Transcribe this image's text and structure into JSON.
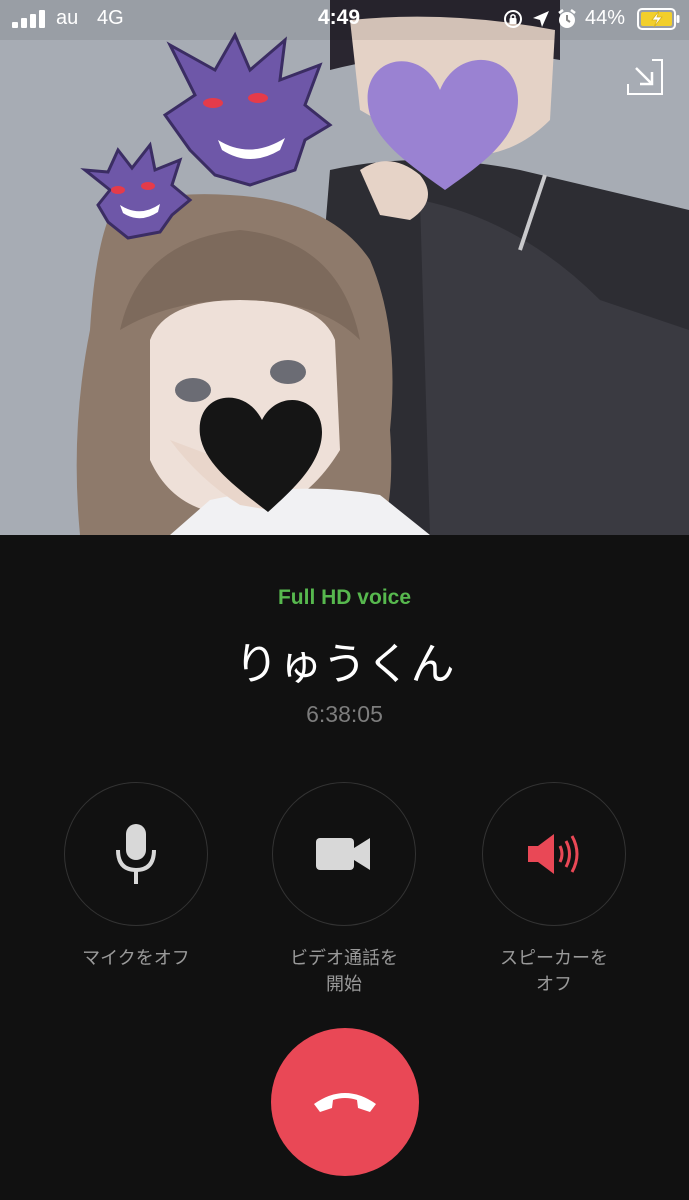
{
  "status_bar": {
    "carrier": "au",
    "network": "4G",
    "time": "4:49",
    "battery_percent": "44%",
    "signal_icon": "signal-bars-icon",
    "battery_icon": "battery-charging-icon"
  },
  "call": {
    "quality_label": "Full HD voice",
    "caller_name": "りゅうくん",
    "duration": "6:38:05"
  },
  "controls": {
    "mic_label": "マイクをオフ",
    "video_label": "ビデオ通話を\n開始",
    "speaker_label": "スピーカーを\nオフ"
  },
  "colors": {
    "background": "#111111",
    "hd_green": "#57b84e",
    "speaker_red": "#e94856",
    "end_call_red": "#e94856"
  }
}
